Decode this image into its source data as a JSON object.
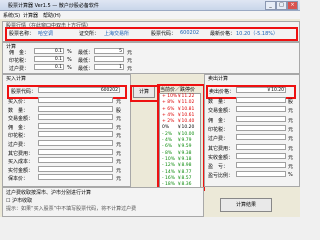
{
  "window": {
    "title": "股票计算器 Ver1.5 — 散户炒股必备软件",
    "min": "_",
    "max": "□",
    "close": "×"
  },
  "menu": [
    "系统(S)",
    "计算器",
    "帮助(H)"
  ],
  "header": {
    "section": "股票行情（在此窗口中双击上方行情）",
    "name_label": "股票名称：",
    "name_value": "哈空调",
    "exchange_label": "证交所：",
    "exchange_value": "上海交易所",
    "code_label": "股票代码：",
    "code_value": "600202",
    "latest_label": "最新价格：",
    "latest_value": "10.20（-5.18%）"
  },
  "calc": {
    "section": "计算",
    "rows": [
      {
        "l": "佣　金：",
        "v": "0.1",
        "u": "%",
        "l2": "最低：",
        "v2": "5",
        "u2": "元"
      },
      {
        "l": "印花税：",
        "v": "0.1",
        "u": "%",
        "l2": "最低：",
        "v2": "",
        "u2": "元"
      },
      {
        "l": "过户费：",
        "v": "0.1",
        "u": "%",
        "l2": "最低：",
        "v2": "1",
        "u2": "元"
      }
    ]
  },
  "buy": {
    "section": "买入计算",
    "code_label": "股票代码：",
    "code_value": "600202",
    "rows": [
      {
        "l": "买入价：",
        "v": "",
        "u": "元"
      },
      {
        "l": "数　量：",
        "v": "",
        "u": "股"
      },
      {
        "l": "交易金额：",
        "v": "",
        "u": "元"
      },
      {
        "l": "佣　金：",
        "v": "",
        "u": "元"
      },
      {
        "l": "印花税：",
        "v": "",
        "u": "元"
      },
      {
        "l": "过户费：",
        "v": "",
        "u": "元"
      },
      {
        "l": "其它费用：",
        "v": "",
        "u": "元"
      },
      {
        "l": "买入成本：",
        "v": "",
        "u": "元"
      },
      {
        "l": "实付金额：",
        "v": "",
        "u": "元"
      },
      {
        "l": "保本价：",
        "v": "",
        "u": "元"
      }
    ]
  },
  "middle": {
    "button": "计算",
    "list_header": "当前价／跌停价",
    "items": [
      {
        "t": "+ 10%",
        "v": "￥11.22",
        "c": "red"
      },
      {
        "t": "+ 8%",
        "v": "￥11.02",
        "c": "red"
      },
      {
        "t": "+ 6%",
        "v": "￥10.81",
        "c": "red"
      },
      {
        "t": "+ 4%",
        "v": "￥10.61",
        "c": "red"
      },
      {
        "t": "+ 2%",
        "v": "￥10.40",
        "c": "red"
      },
      {
        "t": "0%",
        "v": "￥10.20",
        "c": "black"
      },
      {
        "t": "- 2%",
        "v": "￥10.00",
        "c": "green"
      },
      {
        "t": "- 4%",
        "v": "￥9.79",
        "c": "green"
      },
      {
        "t": "- 6%",
        "v": "￥9.59",
        "c": "green"
      },
      {
        "t": "- 8%",
        "v": "￥9.38",
        "c": "green"
      },
      {
        "t": "- 10%",
        "v": "￥9.18",
        "c": "green"
      },
      {
        "t": "- 12%",
        "v": "￥8.98",
        "c": "green"
      },
      {
        "t": "- 14%",
        "v": "￥8.77",
        "c": "green"
      },
      {
        "t": "- 16%",
        "v": "￥8.57",
        "c": "green"
      },
      {
        "t": "- 18%",
        "v": "￥8.36",
        "c": "green"
      }
    ]
  },
  "sell": {
    "section": "卖出计算",
    "price_label": "卖出价格：",
    "price_value": "￥10.20",
    "rows": [
      {
        "l": "数　量：",
        "v": "",
        "u": "股"
      },
      {
        "l": "交易金额：",
        "v": "",
        "u": "元"
      },
      {
        "l": "佣　金：",
        "v": "",
        "u": "元"
      },
      {
        "l": "印花税：",
        "v": "",
        "u": "元"
      },
      {
        "l": "过户费：",
        "v": "",
        "u": "元"
      },
      {
        "l": "其它费用：",
        "v": "",
        "u": "元"
      },
      {
        "l": "实收金额：",
        "v": "",
        "u": "元"
      },
      {
        "l": "盈　亏：",
        "v": "",
        "u": "元"
      },
      {
        "l": "盈亏比例：",
        "v": "",
        "u": "%"
      }
    ]
  },
  "footer": {
    "note": "过户费收取按深市、沪市分别进行计算",
    "check_label": "沪市收取",
    "hint": "提示：如果“买入股票”中不填写股票代码，将不计算过户费",
    "button": "计算结果"
  }
}
